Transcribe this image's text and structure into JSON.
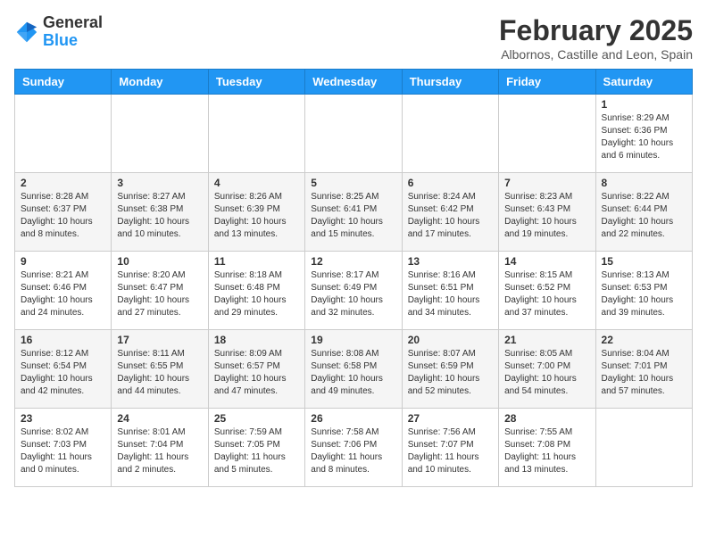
{
  "header": {
    "logo_general": "General",
    "logo_blue": "Blue",
    "month_title": "February 2025",
    "location": "Albornos, Castille and Leon, Spain"
  },
  "days_of_week": [
    "Sunday",
    "Monday",
    "Tuesday",
    "Wednesday",
    "Thursday",
    "Friday",
    "Saturday"
  ],
  "weeks": [
    [
      {
        "day": "",
        "info": ""
      },
      {
        "day": "",
        "info": ""
      },
      {
        "day": "",
        "info": ""
      },
      {
        "day": "",
        "info": ""
      },
      {
        "day": "",
        "info": ""
      },
      {
        "day": "",
        "info": ""
      },
      {
        "day": "1",
        "info": "Sunrise: 8:29 AM\nSunset: 6:36 PM\nDaylight: 10 hours\nand 6 minutes."
      }
    ],
    [
      {
        "day": "2",
        "info": "Sunrise: 8:28 AM\nSunset: 6:37 PM\nDaylight: 10 hours\nand 8 minutes."
      },
      {
        "day": "3",
        "info": "Sunrise: 8:27 AM\nSunset: 6:38 PM\nDaylight: 10 hours\nand 10 minutes."
      },
      {
        "day": "4",
        "info": "Sunrise: 8:26 AM\nSunset: 6:39 PM\nDaylight: 10 hours\nand 13 minutes."
      },
      {
        "day": "5",
        "info": "Sunrise: 8:25 AM\nSunset: 6:41 PM\nDaylight: 10 hours\nand 15 minutes."
      },
      {
        "day": "6",
        "info": "Sunrise: 8:24 AM\nSunset: 6:42 PM\nDaylight: 10 hours\nand 17 minutes."
      },
      {
        "day": "7",
        "info": "Sunrise: 8:23 AM\nSunset: 6:43 PM\nDaylight: 10 hours\nand 19 minutes."
      },
      {
        "day": "8",
        "info": "Sunrise: 8:22 AM\nSunset: 6:44 PM\nDaylight: 10 hours\nand 22 minutes."
      }
    ],
    [
      {
        "day": "9",
        "info": "Sunrise: 8:21 AM\nSunset: 6:46 PM\nDaylight: 10 hours\nand 24 minutes."
      },
      {
        "day": "10",
        "info": "Sunrise: 8:20 AM\nSunset: 6:47 PM\nDaylight: 10 hours\nand 27 minutes."
      },
      {
        "day": "11",
        "info": "Sunrise: 8:18 AM\nSunset: 6:48 PM\nDaylight: 10 hours\nand 29 minutes."
      },
      {
        "day": "12",
        "info": "Sunrise: 8:17 AM\nSunset: 6:49 PM\nDaylight: 10 hours\nand 32 minutes."
      },
      {
        "day": "13",
        "info": "Sunrise: 8:16 AM\nSunset: 6:51 PM\nDaylight: 10 hours\nand 34 minutes."
      },
      {
        "day": "14",
        "info": "Sunrise: 8:15 AM\nSunset: 6:52 PM\nDaylight: 10 hours\nand 37 minutes."
      },
      {
        "day": "15",
        "info": "Sunrise: 8:13 AM\nSunset: 6:53 PM\nDaylight: 10 hours\nand 39 minutes."
      }
    ],
    [
      {
        "day": "16",
        "info": "Sunrise: 8:12 AM\nSunset: 6:54 PM\nDaylight: 10 hours\nand 42 minutes."
      },
      {
        "day": "17",
        "info": "Sunrise: 8:11 AM\nSunset: 6:55 PM\nDaylight: 10 hours\nand 44 minutes."
      },
      {
        "day": "18",
        "info": "Sunrise: 8:09 AM\nSunset: 6:57 PM\nDaylight: 10 hours\nand 47 minutes."
      },
      {
        "day": "19",
        "info": "Sunrise: 8:08 AM\nSunset: 6:58 PM\nDaylight: 10 hours\nand 49 minutes."
      },
      {
        "day": "20",
        "info": "Sunrise: 8:07 AM\nSunset: 6:59 PM\nDaylight: 10 hours\nand 52 minutes."
      },
      {
        "day": "21",
        "info": "Sunrise: 8:05 AM\nSunset: 7:00 PM\nDaylight: 10 hours\nand 54 minutes."
      },
      {
        "day": "22",
        "info": "Sunrise: 8:04 AM\nSunset: 7:01 PM\nDaylight: 10 hours\nand 57 minutes."
      }
    ],
    [
      {
        "day": "23",
        "info": "Sunrise: 8:02 AM\nSunset: 7:03 PM\nDaylight: 11 hours\nand 0 minutes."
      },
      {
        "day": "24",
        "info": "Sunrise: 8:01 AM\nSunset: 7:04 PM\nDaylight: 11 hours\nand 2 minutes."
      },
      {
        "day": "25",
        "info": "Sunrise: 7:59 AM\nSunset: 7:05 PM\nDaylight: 11 hours\nand 5 minutes."
      },
      {
        "day": "26",
        "info": "Sunrise: 7:58 AM\nSunset: 7:06 PM\nDaylight: 11 hours\nand 8 minutes."
      },
      {
        "day": "27",
        "info": "Sunrise: 7:56 AM\nSunset: 7:07 PM\nDaylight: 11 hours\nand 10 minutes."
      },
      {
        "day": "28",
        "info": "Sunrise: 7:55 AM\nSunset: 7:08 PM\nDaylight: 11 hours\nand 13 minutes."
      },
      {
        "day": "",
        "info": ""
      }
    ]
  ]
}
